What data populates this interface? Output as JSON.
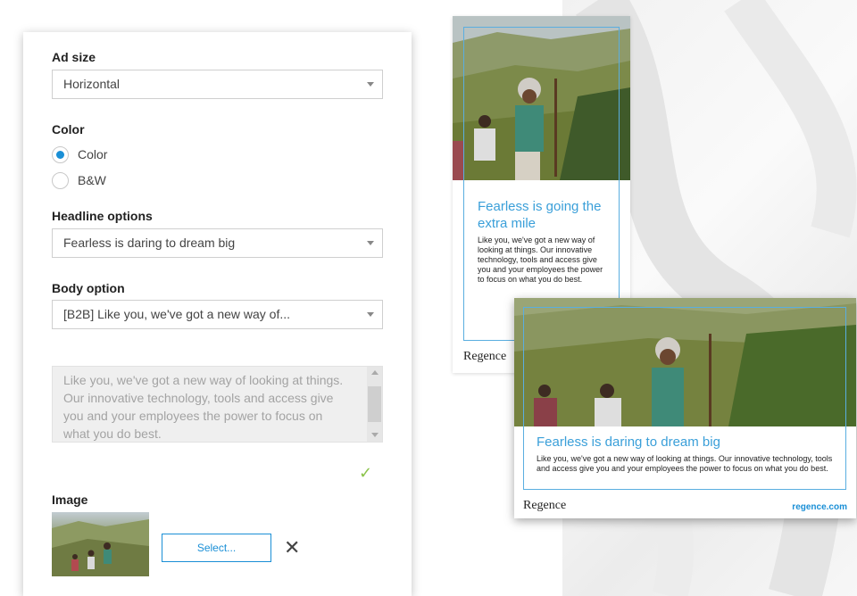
{
  "form": {
    "ad_size": {
      "label": "Ad size",
      "value": "Horizontal"
    },
    "color": {
      "label": "Color",
      "options": [
        {
          "label": "Color",
          "selected": true
        },
        {
          "label": "B&W",
          "selected": false
        }
      ]
    },
    "headline": {
      "label": "Headline options",
      "value": "Fearless is daring to dream big"
    },
    "body": {
      "label": "Body option",
      "value": "[B2B] Like you, we've got a new way of...",
      "text": "Like you, we've got a new way of looking at things. Our innovative technology, tools and access give you and your employees the power to focus on what you do best."
    },
    "valid_mark": "✓",
    "image": {
      "label": "Image",
      "select_label": "Select...",
      "remove_icon": "close-icon"
    }
  },
  "preview_vertical": {
    "headline": "Fearless is going the extra mile",
    "body": "Like you, we've got a new way of looking at things. Our innovative technology, tools and access give you and your employees the power to focus on what you do best.",
    "logo": "Regence"
  },
  "preview_horizontal": {
    "headline": "Fearless is daring to dream big",
    "body": "Like you, we've got a new way of looking at things. Our innovative technology, tools and access give you and your employees the power to focus on what you do best.",
    "logo": "Regence",
    "url": "regence.com"
  },
  "colors": {
    "accent": "#1a8fd6",
    "headline_blue": "#3a9fd9",
    "check_green": "#8bc34a"
  }
}
